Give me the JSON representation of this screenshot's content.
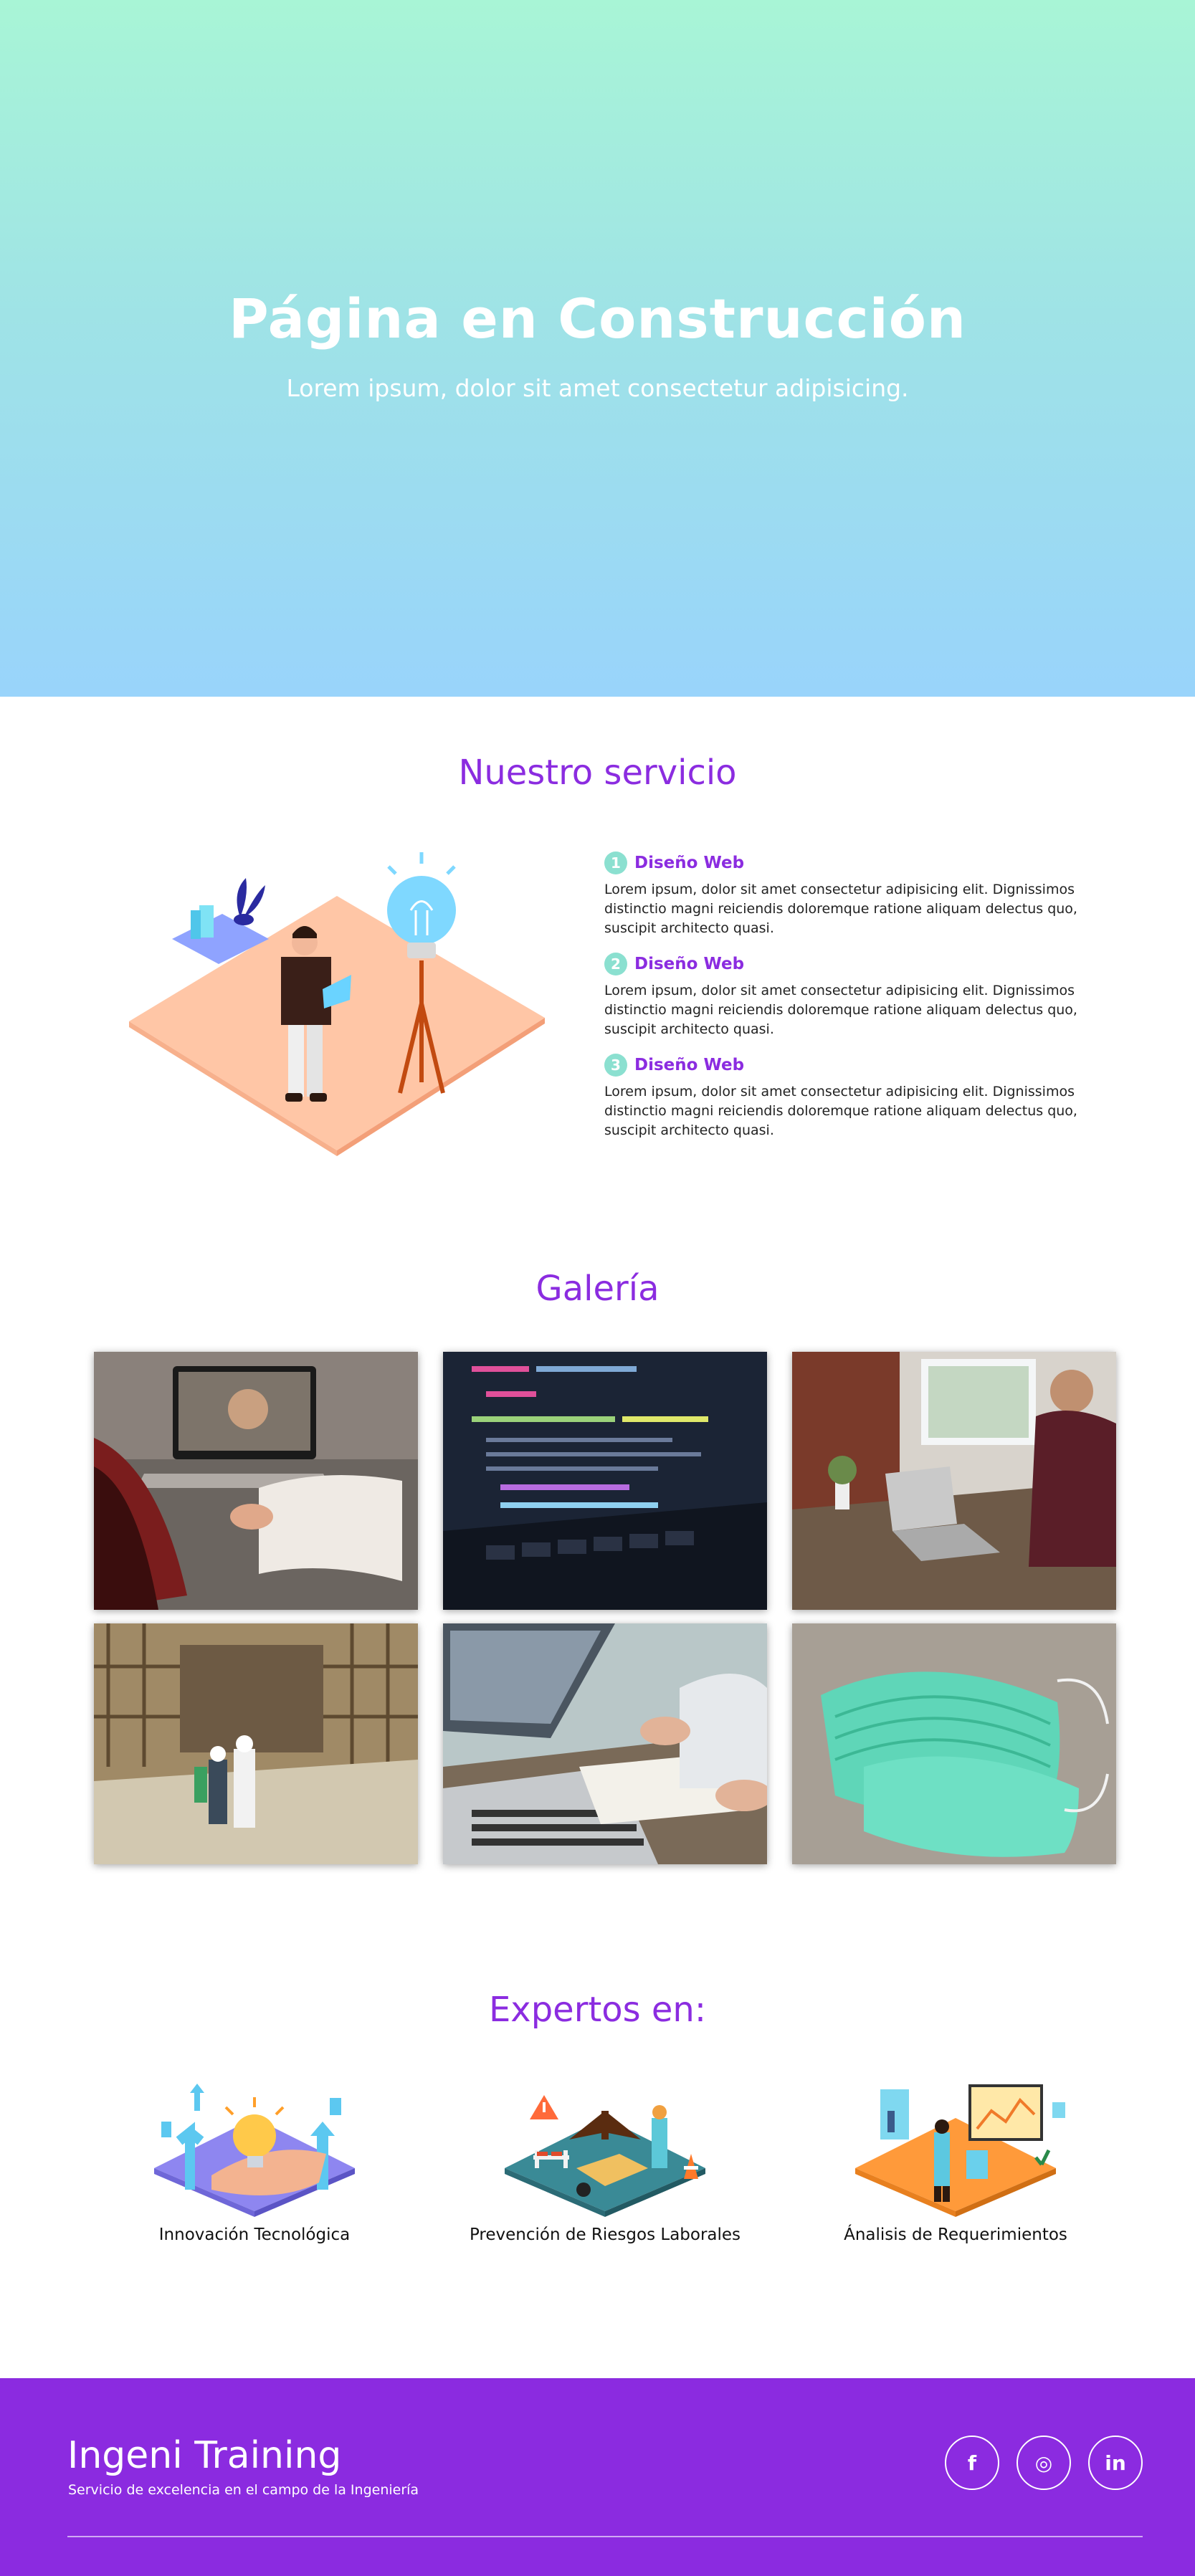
{
  "hero": {
    "title": "Página en Construcción",
    "subtitle": "Lorem ipsum, dolor sit amet consectetur adipisicing."
  },
  "services": {
    "title": "Nuestro servicio",
    "items": [
      {
        "num": "1",
        "name": "Diseño Web",
        "text": "Lorem ipsum, dolor sit amet consectetur adipisicing elit. Dignissimos distinctio magni reiciendis doloremque ratione aliquam delectus quo, suscipit architecto quasi."
      },
      {
        "num": "2",
        "name": "Diseño Web",
        "text": "Lorem ipsum, dolor sit amet consectetur adipisicing elit. Dignissimos distinctio magni reiciendis doloremque ratione aliquam delectus quo, suscipit architecto quasi."
      },
      {
        "num": "3",
        "name": "Diseño Web",
        "text": "Lorem ipsum, dolor sit amet consectetur adipisicing elit. Dignissimos distinctio magni reiciendis doloremque ratione aliquam delectus quo, suscipit architecto quasi."
      }
    ]
  },
  "gallery": {
    "title": "Galería",
    "images": [
      "video-call-photo",
      "code-screen-photo",
      "laptop-desk-photo",
      "construction-site-photo",
      "laptop-notes-photo",
      "face-masks-photo"
    ]
  },
  "experts": {
    "title": "Expertos en:",
    "items": [
      {
        "label": "Innovación Tecnológica",
        "icon": "innovation-illustration"
      },
      {
        "label": "Prevención de Riesgos Laborales",
        "icon": "safety-illustration"
      },
      {
        "label": "Ánalisis de Requerimientos",
        "icon": "analysis-illustration"
      }
    ]
  },
  "footer": {
    "brand": "Ingeni Training",
    "tagline": "Servicio de excelencia en el campo de la Ingeniería",
    "social": [
      {
        "name": "facebook-icon",
        "glyph": "f"
      },
      {
        "name": "instagram-icon",
        "glyph": "◎"
      },
      {
        "name": "linkedin-icon",
        "glyph": "in"
      }
    ]
  },
  "colors": {
    "accent": "#8b2ce0",
    "footer": "#8b2be0",
    "badge": "#8be0d0"
  }
}
